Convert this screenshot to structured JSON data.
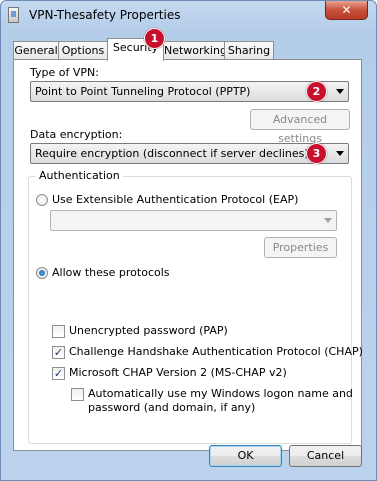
{
  "window": {
    "title": "VPN-Thesafety Properties",
    "close_label": "✕"
  },
  "tabs": [
    {
      "label": "General"
    },
    {
      "label": "Options"
    },
    {
      "label": "Security"
    },
    {
      "label": "Networking"
    },
    {
      "label": "Sharing"
    }
  ],
  "active_tab": "Security",
  "badges": [
    "1",
    "2",
    "3"
  ],
  "security": {
    "vpn_type_label": "Type of VPN:",
    "vpn_type_value": "Point to Point Tunneling Protocol (PPTP)",
    "advanced_settings_label": "Advanced settings",
    "data_encryption_label": "Data encryption:",
    "data_encryption_value": "Require encryption (disconnect if server declines)",
    "authentication": {
      "group_title": "Authentication",
      "eap_label": "Use Extensible Authentication Protocol (EAP)",
      "eap_value": "",
      "properties_label": "Properties",
      "allow_protocols_label": "Allow these protocols",
      "selected": "allow_protocols",
      "protocols": [
        {
          "label": "Unencrypted password (PAP)",
          "checked": false
        },
        {
          "label": "Challenge Handshake Authentication Protocol (CHAP)",
          "checked": true
        },
        {
          "label": "Microsoft CHAP Version 2 (MS-CHAP v2)",
          "checked": true
        }
      ],
      "auto_logon_line1": "Automatically use my Windows logon name and",
      "auto_logon_line2": "password (and domain, if any)",
      "auto_logon_checked": false
    }
  },
  "footer": {
    "ok_label": "OK",
    "cancel_label": "Cancel"
  }
}
